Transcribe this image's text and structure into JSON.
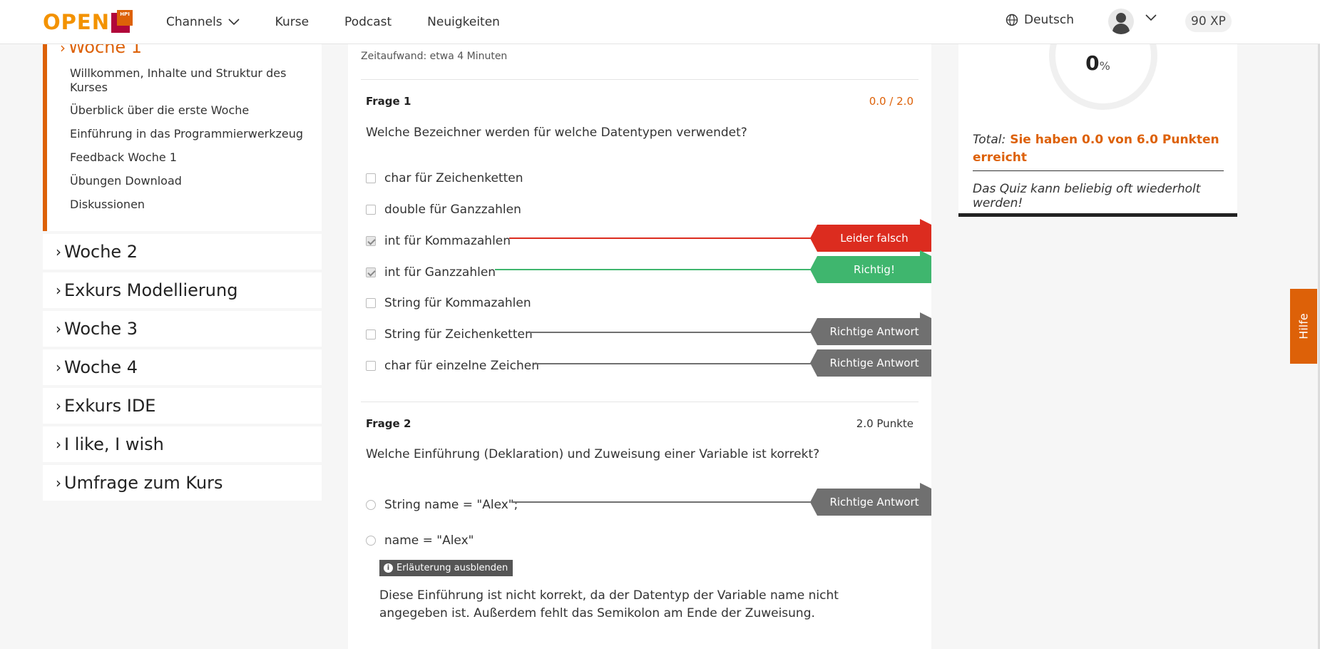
{
  "header": {
    "logo_text": "OPEN",
    "logo_badge": "HPI",
    "nav": [
      {
        "label": "Channels"
      },
      {
        "label": "Kurse"
      },
      {
        "label": "Podcast"
      },
      {
        "label": "Neuigkeiten"
      }
    ],
    "language": "Deutsch",
    "xp": "90 XP"
  },
  "sidebar": {
    "current_week": "Woche 1",
    "items": [
      "Willkommen, Inhalte und Struktur des Kurses",
      "Überblick über die erste Woche",
      "Einführung in das Programmierwerkzeug",
      "Feedback Woche 1",
      "Übungen Download",
      "Diskussionen"
    ],
    "sections": [
      "Woche 2",
      "Exkurs Modellierung",
      "Woche 3",
      "Woche 4",
      "Exkurs IDE",
      "I like, I wish",
      "Umfrage zum Kurs"
    ]
  },
  "quiz": {
    "time_effort": "Zeitaufwand: etwa 4 Minuten",
    "q1": {
      "label": "Frage 1",
      "points": "0.0 / 2.0",
      "text": "Welche Bezeichner werden für welche Datentypen verwendet?",
      "answers": [
        {
          "text": "char für Zeichenketten",
          "checked": false
        },
        {
          "text": "double für Ganzzahlen",
          "checked": false
        },
        {
          "text": "int für Kommazahlen",
          "checked": true
        },
        {
          "text": "int für Ganzzahlen",
          "checked": true
        },
        {
          "text": "String für Kommazahlen",
          "checked": false
        },
        {
          "text": "String für Zeichenketten",
          "checked": false
        },
        {
          "text": "char für einzelne Zeichen",
          "checked": false
        }
      ]
    },
    "q2": {
      "label": "Frage 2",
      "points": "2.0 Punkte",
      "text": "Welche Einführung (Deklaration) und Zuweisung einer Variable ist korrekt?",
      "answers": [
        {
          "text": "String name = \"Alex\";"
        },
        {
          "text": "name = \"Alex\""
        }
      ],
      "explanation_button": "Erläuterung ausblenden",
      "explanation": "Diese Einführung ist nicht korrekt, da der Datentyp der Variable name nicht angegeben ist. Außerdem fehlt das Semikolon am Ende der Zuweisung."
    },
    "tags": {
      "wrong": "Leider falsch",
      "right": "Richtig!",
      "correct_answer": "Richtige Antwort"
    },
    "colors": {
      "wrong": "#dc2c1f",
      "right": "#3fb66e",
      "correct": "#707070",
      "accent": "#dd6108"
    }
  },
  "result": {
    "percent": "0",
    "percent_sign": "%",
    "total_label": "Total:",
    "total_text": "Sie haben 0.0 von 6.0 Punkten erreicht",
    "repeat": "Das Quiz kann beliebig oft wiederholt werden!"
  },
  "help": "Hilfe"
}
